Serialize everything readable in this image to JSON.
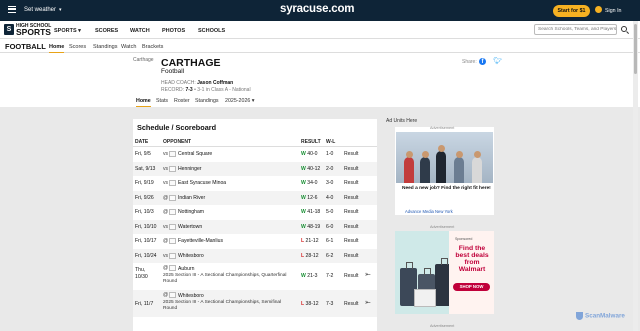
{
  "header": {
    "weather": "Set weather",
    "site_logo": "syracuse.com",
    "start_button": "Start for $1",
    "signin": "Sign In"
  },
  "nav": {
    "hs_logo_line1": "HIGH SCHOOL",
    "hs_logo_line2": "SPORTS",
    "items": [
      "SPORTS",
      "SCORES",
      "WATCH",
      "PHOTOS",
      "SCHOOLS"
    ],
    "sports_chevron": "▾",
    "search_placeholder": "Search Schools, Teams, and Players"
  },
  "sport_nav": {
    "title": "FOOTBALL",
    "links": [
      "Home",
      "Scores",
      "Standings",
      "Watch",
      "Brackets"
    ],
    "active": "Home"
  },
  "team": {
    "logo_alt": "Carthage",
    "name": "CARTHAGE",
    "sport": "Football",
    "coach_label": "HEAD COACH:",
    "coach": "Jason Coffman",
    "record_label": "RECORD:",
    "record_value": "7-3",
    "record_detail": "• 3-1 in Class A - National",
    "share_label": "Share:",
    "tabs": [
      "Home",
      "Stats",
      "Roster",
      "Standings",
      "2025-2026 ▾"
    ]
  },
  "schedule": {
    "title": "Schedule / Scoreboard",
    "columns": [
      "DATE",
      "OPPONENT",
      "RESULT",
      "W-L"
    ],
    "rows": [
      {
        "date": "Fri, 9/5",
        "prefix": "vs",
        "opponent": "Central Square",
        "outcome": "W",
        "score": "40-0",
        "wl": "1-0",
        "link": "Result"
      },
      {
        "date": "Sat, 9/13",
        "prefix": "vs",
        "opponent": "Henninger",
        "outcome": "W",
        "score": "40-12",
        "wl": "2-0",
        "link": "Result"
      },
      {
        "date": "Fri, 9/19",
        "prefix": "vs",
        "opponent": "East Syracuse Minoa",
        "outcome": "W",
        "score": "34-0",
        "wl": "3-0",
        "link": "Result"
      },
      {
        "date": "Fri, 9/26",
        "prefix": "@",
        "opponent": "Indian River",
        "outcome": "W",
        "score": "12-6",
        "wl": "4-0",
        "link": "Result"
      },
      {
        "date": "Fri, 10/3",
        "prefix": "@",
        "opponent": "Nottingham",
        "outcome": "W",
        "score": "41-18",
        "wl": "5-0",
        "link": "Result"
      },
      {
        "date": "Fri, 10/10",
        "prefix": "vs",
        "opponent": "Watertown",
        "outcome": "W",
        "score": "48-19",
        "wl": "6-0",
        "link": "Result"
      },
      {
        "date": "Fri, 10/17",
        "prefix": "@",
        "opponent": "Fayetteville-Manlius",
        "outcome": "L",
        "score": "21-12",
        "wl": "6-1",
        "link": "Result"
      },
      {
        "date": "Fri, 10/24",
        "prefix": "vs",
        "opponent": "Whitesboro",
        "outcome": "L",
        "score": "28-12",
        "wl": "6-2",
        "link": "Result"
      },
      {
        "date_line1": "Thu,",
        "date_line2": "10/30",
        "prefix": "@",
        "opponent": "Auburn",
        "note_line1": "2025 Section III - A Sectional Championships, Quarterfinal",
        "note_line2": "Round",
        "outcome": "W",
        "score": "21-3",
        "wl": "7-2",
        "link": "Result"
      },
      {
        "date": "Fri, 11/7",
        "prefix": "@",
        "opponent": "Whitesboro",
        "note_line1": "2025 Section III - A Sectional Championships, Semifinal",
        "note_line2": "Round",
        "outcome": "L",
        "score": "38-12",
        "wl": "7-3",
        "link": "Result"
      }
    ]
  },
  "ads": {
    "label": "Ad Units Here",
    "tag": "Advertisement",
    "ad1_text": "Need a new job? Find the right fit here!",
    "ad1_link": "Advance Media New York",
    "ad2_small": "Sponsored",
    "ad2_headline": "Find the best deals from Walmart",
    "ad2_button": "SHOP NOW"
  },
  "watermark": "ScanMalware",
  "colors": {
    "nav_bg": "#0e2437",
    "accent": "#f6b122",
    "win": "#1a8f35",
    "loss": "#d62828"
  }
}
